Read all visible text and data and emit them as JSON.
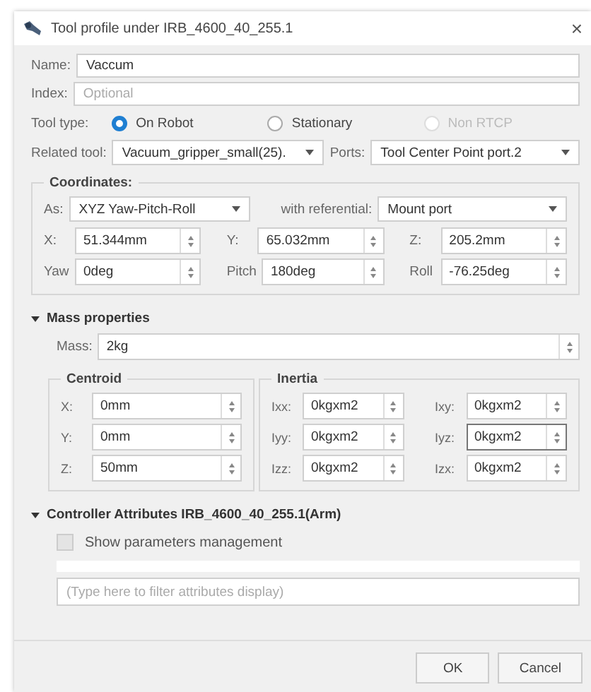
{
  "window": {
    "title": "Tool profile under IRB_4600_40_255.1",
    "close": "×"
  },
  "name": {
    "label": "Name:",
    "value": "Vaccum"
  },
  "index": {
    "label": "Index:",
    "placeholder": "Optional"
  },
  "tool_type": {
    "label": "Tool type:",
    "options": [
      {
        "label": "On Robot",
        "selected": true,
        "disabled": false
      },
      {
        "label": "Stationary",
        "selected": false,
        "disabled": false
      },
      {
        "label": "Non RTCP",
        "selected": false,
        "disabled": true
      }
    ]
  },
  "related_tool": {
    "label": "Related tool:",
    "value": "Vacuum_gripper_small(25)."
  },
  "ports": {
    "label": "Ports:",
    "value": "Tool Center Point port.2"
  },
  "coordinates": {
    "title": "Coordinates:",
    "as": {
      "label": "As:",
      "value": "XYZ Yaw-Pitch-Roll"
    },
    "referential": {
      "label": "with referential:",
      "value": "Mount port"
    },
    "fields": [
      {
        "label": "X:",
        "value": "51.344mm"
      },
      {
        "label": "Y:",
        "value": "65.032mm"
      },
      {
        "label": "Z:",
        "value": "205.2mm"
      },
      {
        "label": "Yaw",
        "value": "0deg"
      },
      {
        "label": "Pitch",
        "value": "180deg"
      },
      {
        "label": "Roll",
        "value": "-76.25deg"
      }
    ]
  },
  "mass_properties": {
    "title": "Mass properties",
    "expanded": true,
    "mass": {
      "label": "Mass:",
      "value": "2kg"
    },
    "centroid": {
      "title": "Centroid",
      "fields": [
        {
          "label": "X:",
          "value": "0mm"
        },
        {
          "label": "Y:",
          "value": "0mm"
        },
        {
          "label": "Z:",
          "value": "50mm"
        }
      ]
    },
    "inertia": {
      "title": "Inertia",
      "fields": [
        {
          "label": "Ixx:",
          "value": "0kgxm2",
          "focused": false
        },
        {
          "label": "Ixy:",
          "value": "0kgxm2",
          "focused": false
        },
        {
          "label": "Iyy:",
          "value": "0kgxm2",
          "focused": false
        },
        {
          "label": "Iyz:",
          "value": "0kgxm2",
          "focused": true
        },
        {
          "label": "Izz:",
          "value": "0kgxm2",
          "focused": false
        },
        {
          "label": "Izx:",
          "value": "0kgxm2",
          "focused": false
        }
      ]
    }
  },
  "controller_attributes": {
    "title": "Controller Attributes IRB_4600_40_255.1(Arm)",
    "expanded": true,
    "show_parameters": {
      "label": "Show parameters management",
      "checked": false
    },
    "filter": {
      "placeholder": "(Type here to filter attributes display)"
    }
  },
  "buttons": [
    "OK",
    "Cancel"
  ]
}
